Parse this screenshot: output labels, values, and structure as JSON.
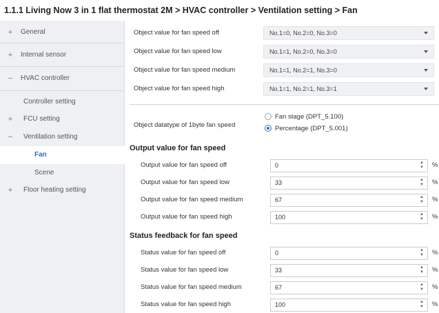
{
  "breadcrumb": "1.1.1 Living Now 3 in 1 flat thermostat 2M > HVAC controller > Ventilation setting > Fan",
  "sidebar": {
    "items": [
      {
        "sign": "+",
        "label": "General"
      },
      {
        "sign": "+",
        "label": "Internal sensor"
      },
      {
        "sign": "−",
        "label": "HVAC controller"
      },
      {
        "sign": "",
        "label": "Controller setting"
      },
      {
        "sign": "+",
        "label": "FCU setting"
      },
      {
        "sign": "−",
        "label": "Ventilation setting"
      },
      {
        "sign": "",
        "label": "Fan"
      },
      {
        "sign": "",
        "label": "Scene"
      },
      {
        "sign": "+",
        "label": "Floor heating setting"
      }
    ]
  },
  "objects": [
    {
      "label": "Object value for fan speed off",
      "value": "No.1=0, No.2=0, No.3=0"
    },
    {
      "label": "Object value for fan speed low",
      "value": "No.1=1, No.2=0, No.3=0"
    },
    {
      "label": "Object value for fan speed medium",
      "value": "No.1=1, No.2=1, No.3=0"
    },
    {
      "label": "Object value for fan speed high",
      "value": "No.1=1, No.2=1, No.3=1"
    }
  ],
  "datatype": {
    "label": "Object datatype of 1byte fan speed",
    "options": [
      "Fan stage (DPT_5.100)",
      "Percentage (DPT_5.001)"
    ],
    "selected": 1
  },
  "output": {
    "title": "Output value for fan speed",
    "unit": "%",
    "rows": [
      {
        "label": "Output value for fan speed off",
        "value": "0"
      },
      {
        "label": "Output value for fan speed low",
        "value": "33"
      },
      {
        "label": "Output value for fan speed medium",
        "value": "67"
      },
      {
        "label": "Output value for fan speed high",
        "value": "100"
      }
    ]
  },
  "status": {
    "title": "Status feedback for fan speed",
    "unit": "%",
    "rows": [
      {
        "label": "Status value for fan speed off",
        "value": "0"
      },
      {
        "label": "Status value for fan speed low",
        "value": "33"
      },
      {
        "label": "Status value for fan speed medium",
        "value": "67"
      },
      {
        "label": "Status value for fan speed high",
        "value": "100"
      }
    ]
  },
  "colors": {
    "accent": "#2a6fba",
    "sidebar_bg": "#eef0f3"
  },
  "icons": {
    "expand": "plus-icon",
    "collapse": "minus-icon",
    "dropdown": "chevron-down-icon",
    "spinner": "spinner-arrows-icon"
  }
}
